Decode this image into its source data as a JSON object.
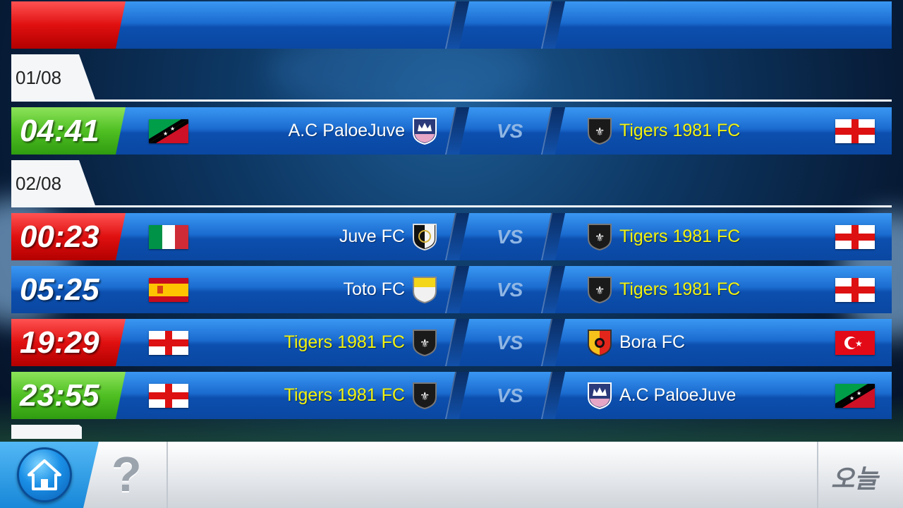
{
  "dates": [
    {
      "label": "01/08"
    },
    {
      "label": "02/08"
    }
  ],
  "matches": [
    {
      "time": "04:41",
      "home": "A.C PaloeJuve",
      "away": "Tigers 1981 FC",
      "vs": "VS"
    },
    {
      "time": "00:23",
      "home": "Juve FC",
      "away": "Tigers 1981 FC",
      "vs": "VS"
    },
    {
      "time": "05:25",
      "home": "Toto FC",
      "away": "Tigers 1981 FC",
      "vs": "VS"
    },
    {
      "time": "19:29",
      "home": "Tigers 1981 FC",
      "away": "Bora FC",
      "vs": "VS"
    },
    {
      "time": "23:55",
      "home": "Tigers 1981 FC",
      "away": "A.C PaloeJuve",
      "vs": "VS"
    }
  ],
  "flags": {
    "m0_home": "saint-kitts-and-nevis-flag",
    "m0_away": "england-flag",
    "m1_home": "italy-flag",
    "m1_away": "england-flag",
    "m2_home": "spain-flag",
    "m2_away": "england-flag",
    "m3_home": "england-flag",
    "m3_away": "turkey-flag",
    "m4_home": "england-flag",
    "m4_away": "saint-kitts-and-nevis-flag"
  },
  "colors": {
    "time_green": "#4fbf23",
    "time_red": "#e01010",
    "highlight_team": "#f3f20e",
    "row_blue": "#1b6cd0"
  },
  "bottombar": {
    "home_icon": "home-icon",
    "help_label": "?",
    "today_label": "오늘"
  }
}
